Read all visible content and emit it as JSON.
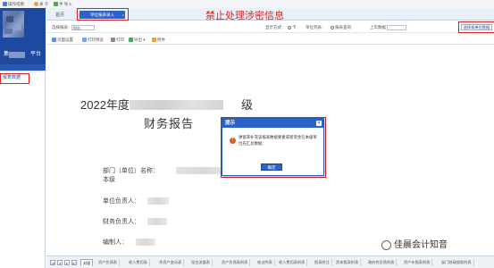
{
  "topbar": {
    "items": [
      {
        "label": "操作指南",
        "icon": "book-icon"
      },
      {
        "label": "关 于",
        "icon": "info-icon"
      },
      {
        "label": "手 导入",
        "icon": "import-icon"
      }
    ]
  },
  "sidebar": {
    "title": "集　　　　平台",
    "nav_item": "报表数据"
  },
  "tabs": {
    "home": "首页",
    "active": "单位报表录入",
    "close": "×"
  },
  "banner": "禁止处理涉密信息",
  "row1": {
    "report_label": "选择报表：",
    "report_value": "财务",
    "opt1": "显示方式：",
    "opt2": "卡",
    "opt3": "单位列表：",
    "opt4": "报表查询",
    "opt5": "上年数据",
    "unit_button": "选择本单位数据"
  },
  "row2": {
    "buttons": [
      {
        "label": "页面设置",
        "icon": "page-setup-icon"
      },
      {
        "label": "打印预览",
        "icon": "print-preview-icon"
      },
      {
        "label": "打印",
        "icon": "print-icon"
      },
      {
        "label": "导出 ▾",
        "icon": "export-icon"
      },
      {
        "label": "附件",
        "icon": "attachment-icon"
      }
    ]
  },
  "document": {
    "title_year": "2022年度",
    "title_level": "级",
    "title_main": "财务报告",
    "fields": [
      {
        "label": "部门（单位）名称："
      },
      {
        "label": "本级"
      },
      {
        "label": "单位负责人："
      },
      {
        "label": "财务负责人："
      },
      {
        "label": "编制人："
      }
    ]
  },
  "modal": {
    "title": "提示",
    "close": "×",
    "icon": "!",
    "message": "弹窗来补充该报表数据要素或者资金在本级单位先汇总数据：",
    "ok": "确定"
  },
  "sheets": {
    "nav": [
      "|◂",
      "◂",
      "▸",
      "▸|"
    ],
    "tabs": [
      "封面",
      "资产负债表",
      "收入费用表",
      "净资产变动表",
      "现金流量表",
      "资产负债表附表",
      "收支附表",
      "收入费用表附表",
      "报表附注",
      "资本报表附表",
      "政府性负债附表",
      "资产年报表附表",
      "部门财政拨款附表"
    ]
  },
  "watermark": {
    "text": "佳晨会计知音",
    "icon": "wechat-icon"
  },
  "colors": {
    "primary": "#2c63c9",
    "sidebar": "#1d4aa0",
    "annotation": "#e02020"
  }
}
